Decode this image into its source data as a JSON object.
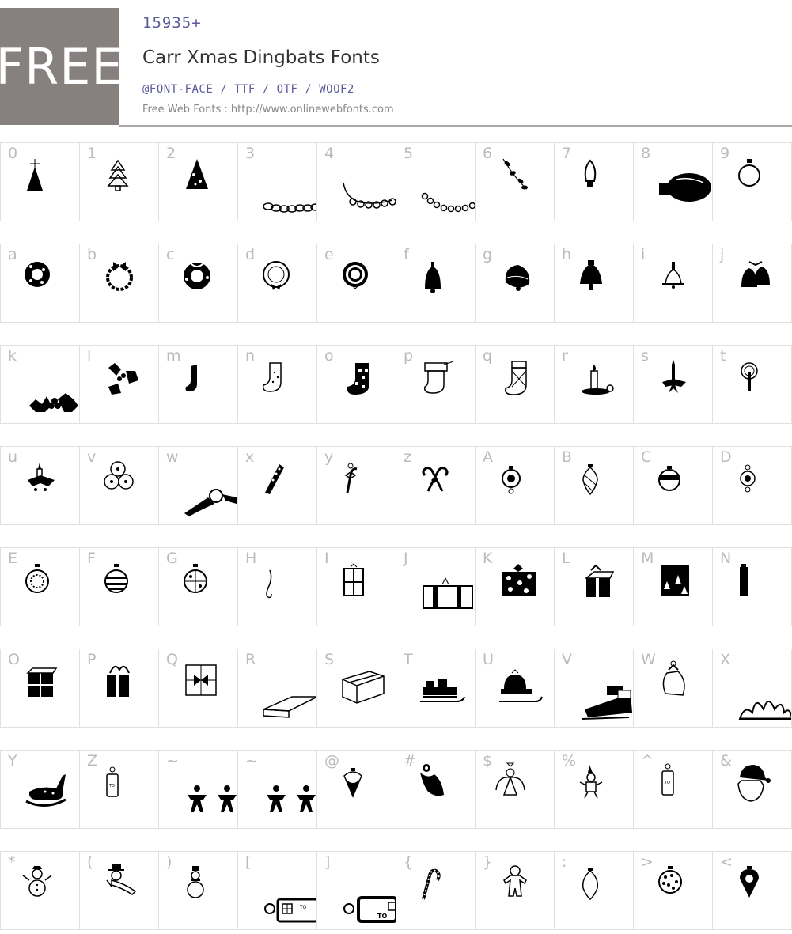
{
  "header": {
    "badge": "FREE",
    "count": "15935+",
    "title": "Carr Xmas Dingbats Fonts",
    "formats": "@FONT-FACE / TTF / OTF / WOOF2",
    "site": "Free Web Fonts : http://www.onlinewebfonts.com"
  },
  "rows": [
    {
      "keys": [
        "0",
        "1",
        "2",
        "3",
        "4",
        "5",
        "6",
        "7",
        "8",
        "9"
      ],
      "glyphs": [
        "tree-star-icon",
        "pine-tree-icon",
        "decorated-tree-icon",
        "garland-icon",
        "bead-garland-icon",
        "garland-beads-icon",
        "holly-sprig-icon",
        "light-bulb-icon",
        "big-light-bulb-icon",
        "ornament-ball-icon"
      ]
    },
    {
      "keys": [
        "a",
        "b",
        "c",
        "d",
        "e",
        "f",
        "g",
        "h",
        "i",
        "j"
      ],
      "glyphs": [
        "wreath-dark-icon",
        "wreath-bow-icon",
        "wreath-leafy-icon",
        "wreath-ring-icon",
        "wreath-double-icon",
        "bell-icon",
        "bell-tilted-icon",
        "bell-solid-icon",
        "bell-small-icon",
        "bells-pair-icon"
      ]
    },
    {
      "keys": [
        "k",
        "l",
        "m",
        "n",
        "o",
        "p",
        "q",
        "r",
        "s",
        "t"
      ],
      "glyphs": [
        "holly-berries-icon",
        "holly-cluster-icon",
        "stocking-dark-icon",
        "stocking-dotted-icon",
        "stocking-checkered-icon",
        "stocking-cuffed-icon",
        "stocking-argyle-icon",
        "candle-holder-icon",
        "candle-holly-icon",
        "candle-glow-icon"
      ]
    },
    {
      "keys": [
        "u",
        "v",
        "w",
        "x",
        "y",
        "z",
        "A",
        "B",
        "C",
        "D"
      ],
      "glyphs": [
        "candle-wreath-icon",
        "ornament-trio-icon",
        "ribbon-wreath-icon",
        "candy-stripe-icon",
        "candy-cane-bow-icon",
        "candy-canes-crossed-icon",
        "ornament-round-icon",
        "ornament-drop-icon",
        "ornament-banded-icon",
        "ornament-jewel-icon"
      ]
    },
    {
      "keys": [
        "E",
        "F",
        "G",
        "H",
        "I",
        "J",
        "K",
        "L",
        "M",
        "N"
      ],
      "glyphs": [
        "ornament-lace-icon",
        "ornament-striped-icon",
        "ornament-pattern-icon",
        "ornament-hook-icon",
        "gift-tall-icon",
        "gift-wide-icon",
        "gift-dotted-icon",
        "gift-bow-icon",
        "gift-trees-icon",
        "gift-slim-icon"
      ]
    },
    {
      "keys": [
        "O",
        "P",
        "Q",
        "R",
        "S",
        "T",
        "U",
        "V",
        "W",
        "X"
      ],
      "glyphs": [
        "gift-stack-icon",
        "gift-flowers-icon",
        "gift-bow-square-icon",
        "gift-flat-box-icon",
        "gift-box-3d-icon",
        "sleigh-gifts-icon",
        "sleigh-pudding-icon",
        "sleigh-loaded-icon",
        "gift-sack-icon",
        "poinsettia-icon"
      ]
    },
    {
      "keys": [
        "Y",
        "Z",
        "~",
        "~",
        "@",
        "#",
        "$",
        "%",
        "^",
        "&"
      ],
      "glyphs": [
        "rocking-horse-icon",
        "gift-tag-icon",
        "paper-dolls-icon",
        "paper-dolls-icon",
        "ornament-spinner-icon",
        "angel-dark-icon",
        "angel-outline-icon",
        "elf-icon",
        "gift-tag-tall-icon",
        "santa-face-icon"
      ]
    },
    {
      "keys": [
        "*",
        "(",
        ")",
        "[",
        "]",
        "{",
        "}",
        ":",
        ">",
        "<"
      ],
      "glyphs": [
        "snowman-icon",
        "snowman-scarf-icon",
        "snowman-small-icon",
        "gift-tag-label-icon",
        "gift-tag-label-bold-icon",
        "candy-cane-icon",
        "gingerbread-man-icon",
        "ornament-teardrop-icon",
        "ornament-dots-icon",
        "ornament-pointed-icon"
      ]
    }
  ]
}
